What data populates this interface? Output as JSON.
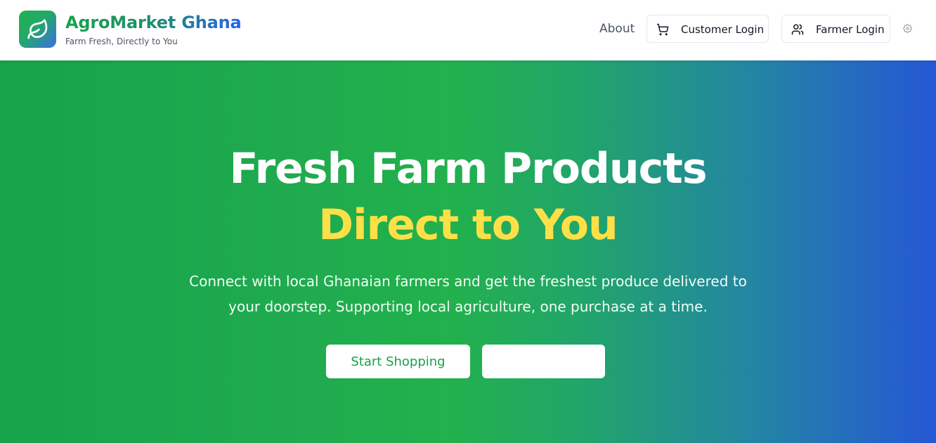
{
  "brand": {
    "name": "AgroMarket Ghana",
    "tagline": "Farm Fresh, Directly to You",
    "logo_icon": "leaf-icon"
  },
  "nav": {
    "about_label": "About",
    "customer_login": {
      "label": "Customer Login",
      "icon": "cart-icon"
    },
    "farmer_login": {
      "label": "Farmer Login",
      "icon": "users-icon"
    },
    "settings_icon": "gear-icon"
  },
  "hero": {
    "title": "Fresh Farm Products",
    "highlight": "Direct to You",
    "description": "Connect with local Ghanaian farmers and get the freshest produce delivered to your doorstep. Supporting local agriculture, one purchase at a time.",
    "primary_button": "Start Shopping",
    "secondary_button": ""
  },
  "colors": {
    "brand_green": "#16a34a",
    "brand_blue": "#2563eb",
    "highlight_yellow": "#fde047"
  }
}
